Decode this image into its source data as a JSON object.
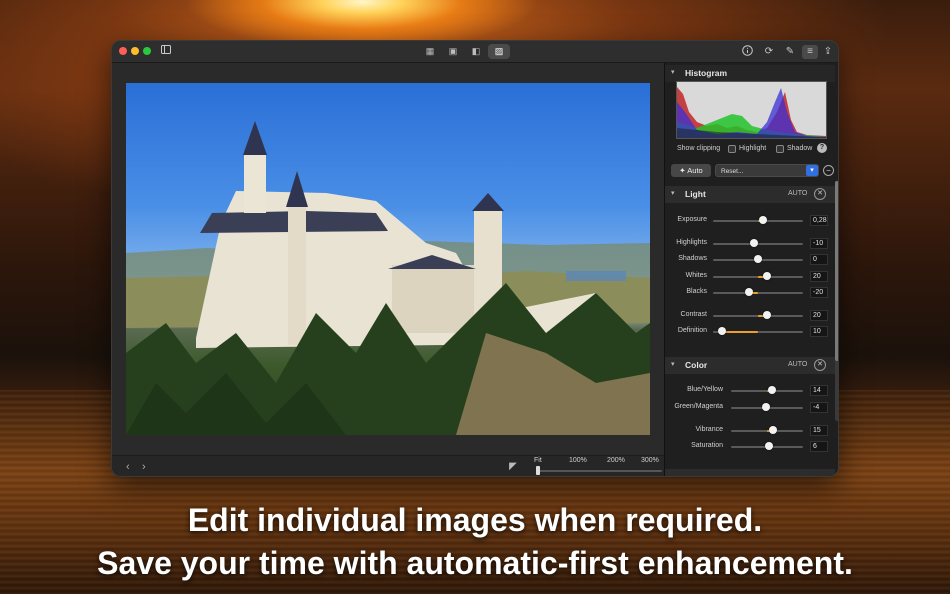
{
  "toolbar": {
    "view_modes": [
      "grid-view-icon",
      "single-image-icon",
      "compare-icon",
      "edit-view-icon"
    ],
    "right_icons": [
      "info-icon",
      "crop-rotate-icon",
      "tools-icon",
      "adjustments-icon",
      "share-icon"
    ]
  },
  "viewer": {
    "nav_prev": "‹",
    "nav_next": "›",
    "zoom_labels": [
      "Fit",
      "100%",
      "200%",
      "300%"
    ]
  },
  "histogram": {
    "title": "Histogram",
    "show_clipping": "Show clipping",
    "highlight": "Highlight",
    "shadow": "Shadow",
    "help": "?"
  },
  "auto_bar": {
    "auto_label": "Auto",
    "preset_value": "Reset..."
  },
  "light": {
    "title": "Light",
    "auto": "AUTO",
    "sliders": [
      {
        "label": "Exposure",
        "value": "0,28",
        "level": 0.55
      },
      {
        "label": "Highlights",
        "value": "-10",
        "level": 0.45
      },
      {
        "label": "Shadows",
        "value": "0",
        "level": 0.5
      },
      {
        "label": "Whites",
        "value": "20",
        "level": 0.6
      },
      {
        "label": "Blacks",
        "value": "-20",
        "level": 0.4
      },
      {
        "label": "Contrast",
        "value": "20",
        "level": 0.6
      },
      {
        "label": "Definition",
        "value": "10",
        "level": 0.1
      }
    ]
  },
  "color": {
    "title": "Color",
    "auto": "AUTO",
    "sliders": [
      {
        "label": "Blue/Yellow",
        "value": "14",
        "level": 0.57
      },
      {
        "label": "Green/Magenta",
        "value": "-4",
        "level": 0.48
      },
      {
        "label": "Vibrance",
        "value": "15",
        "level": 0.58
      },
      {
        "label": "Saturation",
        "value": "6",
        "level": 0.53
      }
    ]
  },
  "captions": {
    "line1": "Edit individual images when required.",
    "line2": "Save your time with automatic-first enhancement."
  },
  "colors": {
    "accent": "#e9a02a",
    "selection_blue": "#2f6fe0",
    "traffic_red": "#ff5f57",
    "traffic_yellow": "#febc2e",
    "traffic_green": "#28c840"
  }
}
